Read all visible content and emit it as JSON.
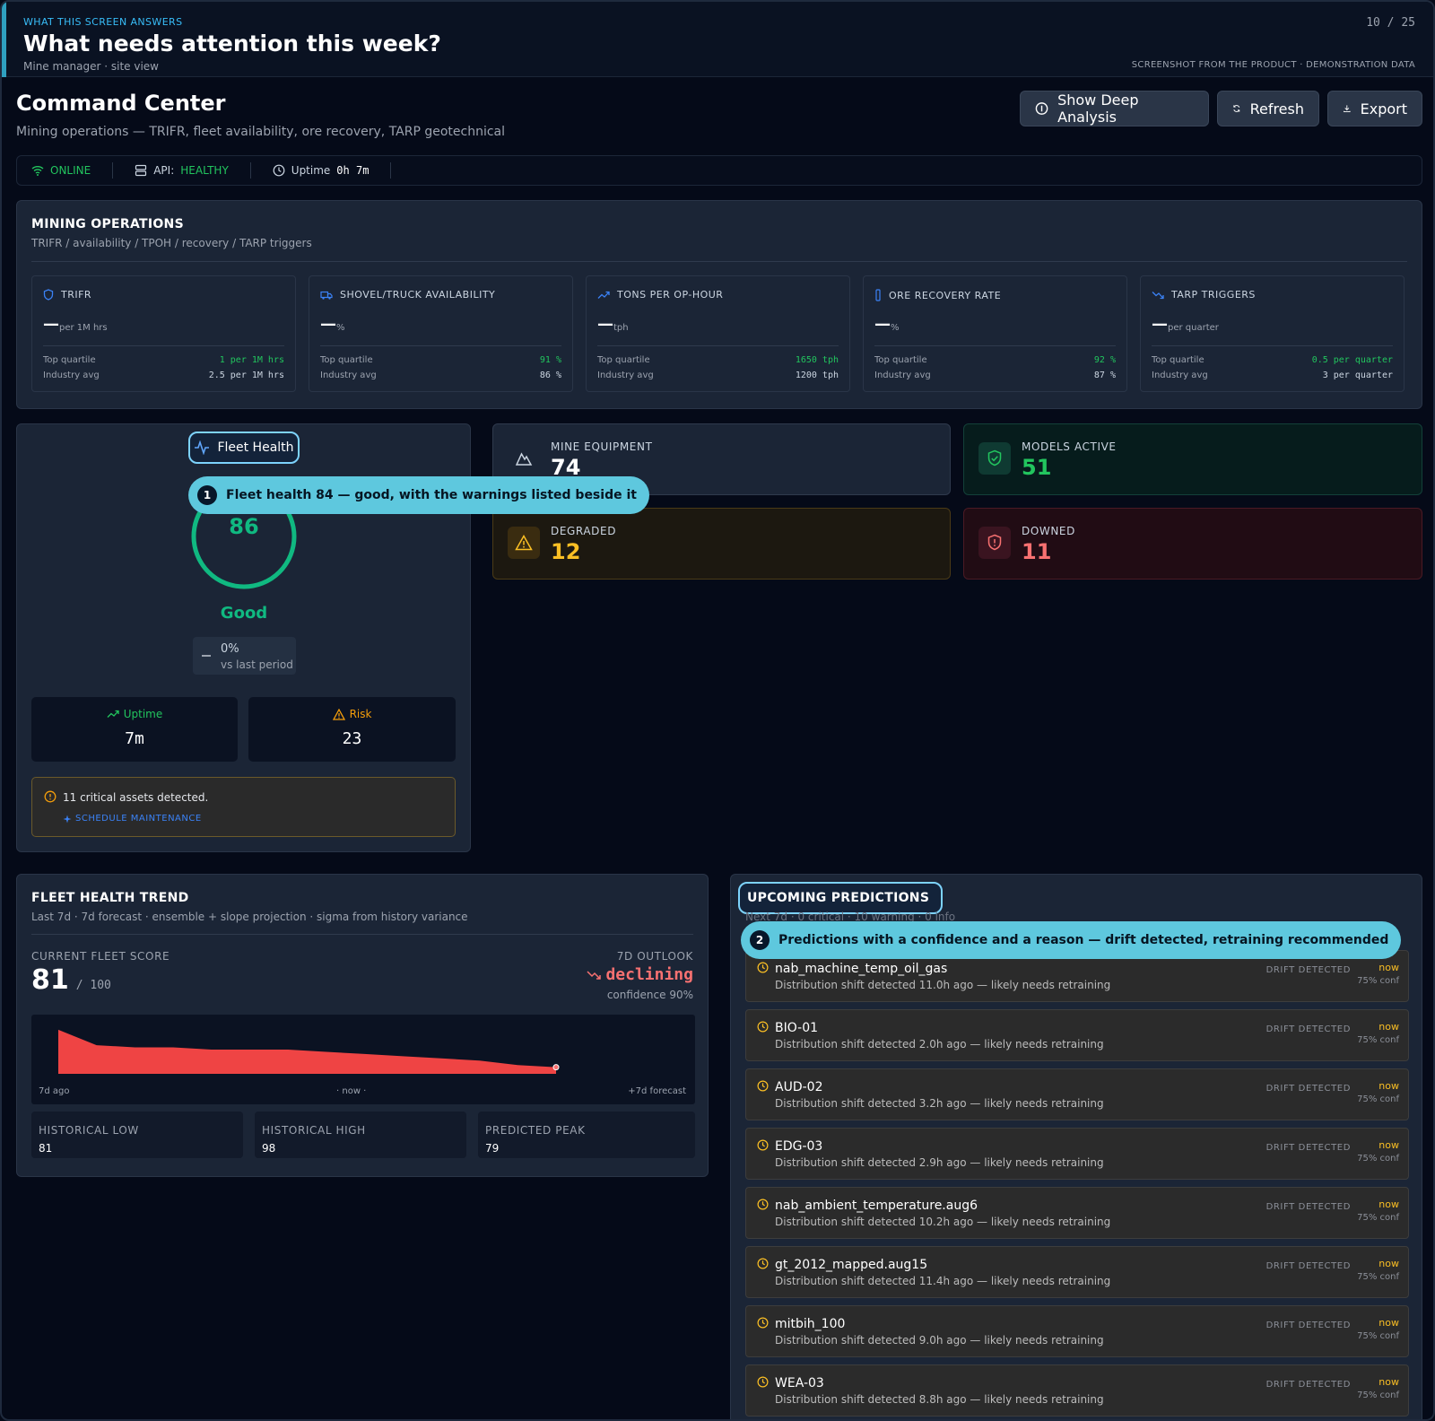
{
  "banner": {
    "kicker": "WHAT THIS SCREEN ANSWERS",
    "title": "What needs attention this week?",
    "subtitle": "Mine manager · site view",
    "page": "10 / 25",
    "note": "SCREENSHOT FROM THE PRODUCT · DEMONSTRATION DATA"
  },
  "header": {
    "title": "Command Center",
    "subtitle": "Mining operations — TRIFR, fleet availability, ore recovery, TARP geotechnical",
    "buttons": {
      "deep": "Show Deep Analysis",
      "refresh": "Refresh",
      "export": "Export"
    }
  },
  "status": {
    "online": "ONLINE",
    "api_label": "API:",
    "api_value": "HEALTHY",
    "uptime_label": "Uptime",
    "uptime_value": "0h 7m"
  },
  "mining": {
    "title": "MINING OPERATIONS",
    "subtitle": "TRIFR / availability / TPOH / recovery / TARP triggers",
    "kpis": [
      {
        "title": "TRIFR",
        "value": "—",
        "unit": "per 1M hrs",
        "top_label": "Top quartile",
        "top": "1 per 1M hrs",
        "avg_label": "Industry avg",
        "avg": "2.5 per 1M hrs",
        "icon": "shield-icon"
      },
      {
        "title": "SHOVEL/TRUCK AVAILABILITY",
        "value": "—",
        "unit": "%",
        "top_label": "Top quartile",
        "top": "91 %",
        "avg_label": "Industry avg",
        "avg": "86 %",
        "icon": "truck-icon"
      },
      {
        "title": "TONS PER OP-HOUR",
        "value": "—",
        "unit": "tph",
        "top_label": "Top quartile",
        "top": "1650 tph",
        "avg_label": "Industry avg",
        "avg": "1200 tph",
        "icon": "trend-up-icon"
      },
      {
        "title": "ORE RECOVERY RATE",
        "value": "—",
        "unit": "%",
        "top_label": "Top quartile",
        "top": "92 %",
        "avg_label": "Industry avg",
        "avg": "87 %",
        "icon": "beaker-icon"
      },
      {
        "title": "TARP TRIGGERS",
        "value": "—",
        "unit": "per quarter",
        "top_label": "Top quartile",
        "top": "0.5 per quarter",
        "avg_label": "Industry avg",
        "avg": "3 per quarter",
        "icon": "trend-down-icon"
      }
    ]
  },
  "fleet_health": {
    "tab": "Fleet Health",
    "score": "86",
    "score_fraction": 0.86,
    "rating": "Good",
    "delta": "0%",
    "delta_label": "vs last period",
    "uptime_label": "Uptime",
    "uptime_value": "7m",
    "risk_label": "Risk",
    "risk_value": "23",
    "alert_text": "11 critical assets detected.",
    "alert_action": "SCHEDULE MAINTENANCE"
  },
  "callouts": {
    "one_num": "1",
    "one": "Fleet health 84 — good, with the warnings listed beside it",
    "two_num": "2",
    "two": "Predictions with a confidence and a reason — drift detected, retraining recommended"
  },
  "stats": {
    "equipment": {
      "label": "MINE EQUIPMENT",
      "value": "74"
    },
    "models": {
      "label": "MODELS ACTIVE",
      "value": "51"
    },
    "degraded": {
      "label": "DEGRADED",
      "value": "12"
    },
    "downed": {
      "label": "DOWNED",
      "value": "11"
    }
  },
  "trend": {
    "title": "FLEET HEALTH TREND",
    "subtitle": "Last 7d · 7d forecast · ensemble + slope projection · sigma from history variance",
    "current_label": "CURRENT FLEET SCORE",
    "current_value": "81",
    "current_max": "/ 100",
    "outlook_label": "7D OUTLOOK",
    "outlook_value": "declining",
    "confidence": "confidence 90%",
    "x_start": "7d ago",
    "x_mid": "· now ·",
    "x_end": "+7d forecast",
    "low_label": "HISTORICAL LOW",
    "low_value": "81",
    "high_label": "HISTORICAL HIGH",
    "high_value": "98",
    "peak_label": "PREDICTED PEAK",
    "peak_value": "79"
  },
  "chart_data": {
    "type": "area",
    "x": [
      0,
      1,
      2,
      3,
      4,
      5,
      6,
      7,
      8,
      9,
      10,
      11,
      12,
      13
    ],
    "series": [
      {
        "values": [
          98,
          91,
          90,
          90,
          89,
          89,
          89,
          88,
          87,
          86,
          85,
          84,
          82,
          81
        ]
      }
    ],
    "ylim": [
      78,
      100
    ],
    "color": "#ef4444"
  },
  "predictions": {
    "title": "UPCOMING PREDICTIONS",
    "subtitle": "Next 7d · 0 critical · 10 warning · 0 info",
    "items": [
      {
        "name": "nab_machine_temp_oil_gas",
        "desc": "Distribution shift detected 11.0h ago — likely needs retraining",
        "tag": "DRIFT DETECTED",
        "when": "now",
        "conf": "75% conf"
      },
      {
        "name": "BIO-01",
        "desc": "Distribution shift detected 2.0h ago — likely needs retraining",
        "tag": "DRIFT DETECTED",
        "when": "now",
        "conf": "75% conf"
      },
      {
        "name": "AUD-02",
        "desc": "Distribution shift detected 3.2h ago — likely needs retraining",
        "tag": "DRIFT DETECTED",
        "when": "now",
        "conf": "75% conf"
      },
      {
        "name": "EDG-03",
        "desc": "Distribution shift detected 2.9h ago — likely needs retraining",
        "tag": "DRIFT DETECTED",
        "when": "now",
        "conf": "75% conf"
      },
      {
        "name": "nab_ambient_temperature.aug6",
        "desc": "Distribution shift detected 10.2h ago — likely needs retraining",
        "tag": "DRIFT DETECTED",
        "when": "now",
        "conf": "75% conf"
      },
      {
        "name": "gt_2012_mapped.aug15",
        "desc": "Distribution shift detected 11.4h ago — likely needs retraining",
        "tag": "DRIFT DETECTED",
        "when": "now",
        "conf": "75% conf"
      },
      {
        "name": "mitbih_100",
        "desc": "Distribution shift detected 9.0h ago — likely needs retraining",
        "tag": "DRIFT DETECTED",
        "when": "now",
        "conf": "75% conf"
      },
      {
        "name": "WEA-03",
        "desc": "Distribution shift detected 8.8h ago — likely needs retraining",
        "tag": "DRIFT DETECTED",
        "when": "now",
        "conf": "75% conf"
      }
    ]
  }
}
